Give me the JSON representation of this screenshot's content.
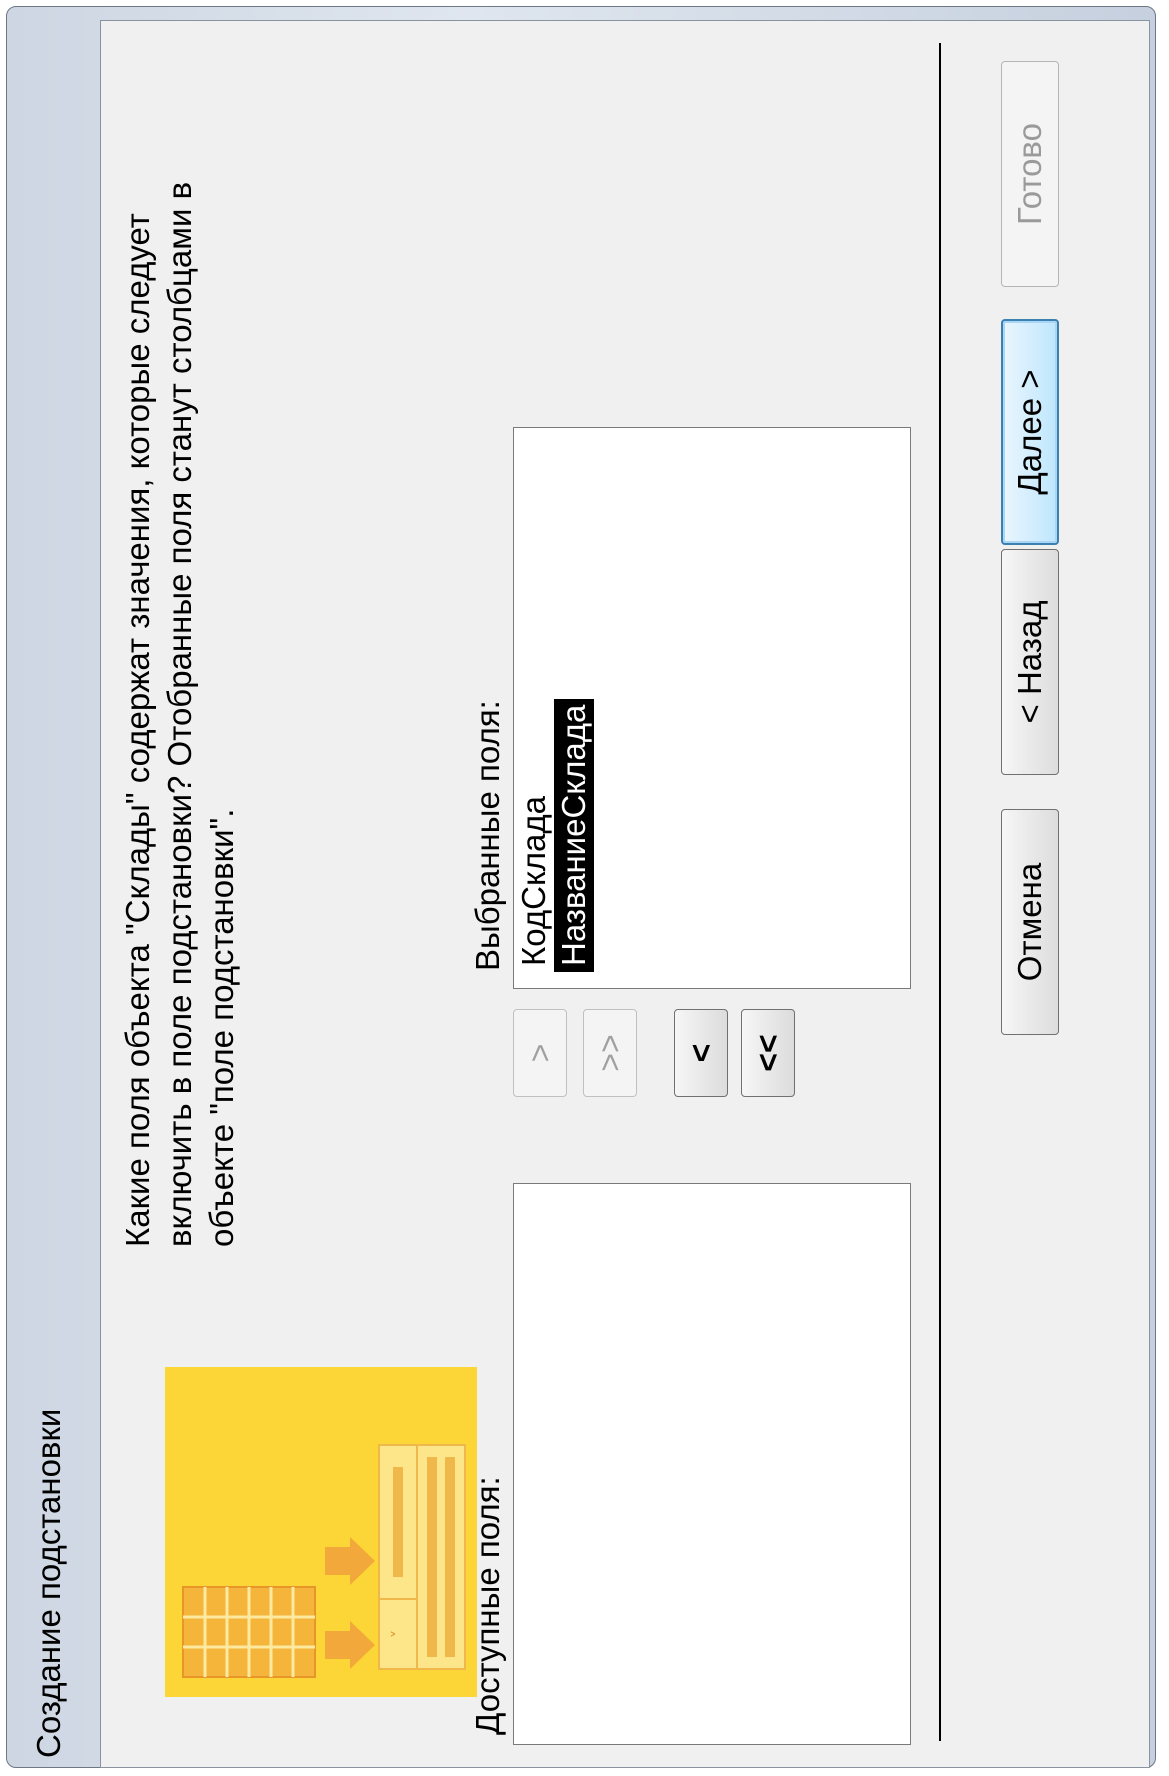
{
  "window": {
    "title": "Создание подстановки"
  },
  "wizard": {
    "question": "Какие поля объекта \"Склады\" содержат значения, которые следует включить в поле подстановки? Отобранные поля станут столбцами в объекте \"поле подстановки\".",
    "available_label": "Доступные поля:",
    "selected_label": "Выбранные поля:",
    "available_fields": [],
    "selected_fields": [
      "КодСклада",
      "НазваниеСклада"
    ],
    "selected_item_highlighted": "НазваниеСклада",
    "move_buttons": {
      "add_one": ">",
      "add_all": ">>",
      "remove_one": "<",
      "remove_all": "<<"
    }
  },
  "buttons": {
    "cancel": "Отмена",
    "back": "< Назад",
    "next": "Далее >",
    "finish": "Готово"
  },
  "colors": {
    "wizard_image": "#fcd636",
    "selection": "#000000",
    "default_button_border": "#3c7fb1"
  }
}
